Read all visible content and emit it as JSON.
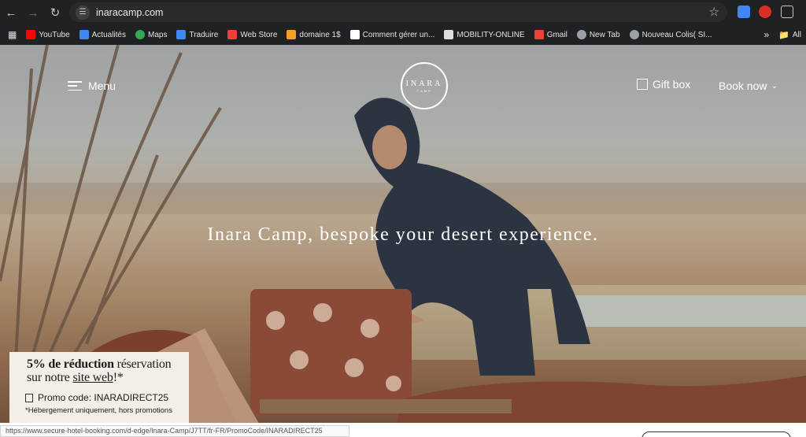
{
  "browser": {
    "url": "inaracamp.com",
    "bookmarks": [
      {
        "label": "YouTube",
        "color": "#ff0000"
      },
      {
        "label": "Actualités",
        "color": "#4285f4"
      },
      {
        "label": "Maps",
        "color": "#34a853"
      },
      {
        "label": "Traduire",
        "color": "#4285f4"
      },
      {
        "label": "Web Store",
        "color": "#ea4335"
      },
      {
        "label": "domaine 1$",
        "color": "#f4a020"
      },
      {
        "label": "Comment gérer un...",
        "color": "#ffffff"
      },
      {
        "label": "MOBILITY-ONLINE",
        "color": "#dddddd"
      },
      {
        "label": "Gmail",
        "color": "#ea4335"
      },
      {
        "label": "New Tab",
        "color": "#9aa0a6"
      },
      {
        "label": "Nouveau Colis( SI...",
        "color": "#9aa0a6"
      }
    ],
    "more": "»",
    "all_bookmarks": "All"
  },
  "site": {
    "menu_label": "Menu",
    "logo_text": "INARA",
    "logo_sub": "CAMP",
    "gift_label": "Gift box",
    "book_label": "Book now",
    "headline": "Inara Camp, bespoke your desert experience."
  },
  "promo": {
    "bold": "5% de réduction",
    "rest1": " réservation",
    "line2_pre": "sur notre ",
    "link": "site web",
    "line2_post": "!*",
    "code": "Promo code: INARADIRECT25",
    "note": "*Hébergement uniquement, hors promotions"
  },
  "status_url": "https://www.secure-hotel-booking.com/d-edge/Inara-Camp/J7TT/fr-FR/PromoCode/INARADIRECT25"
}
